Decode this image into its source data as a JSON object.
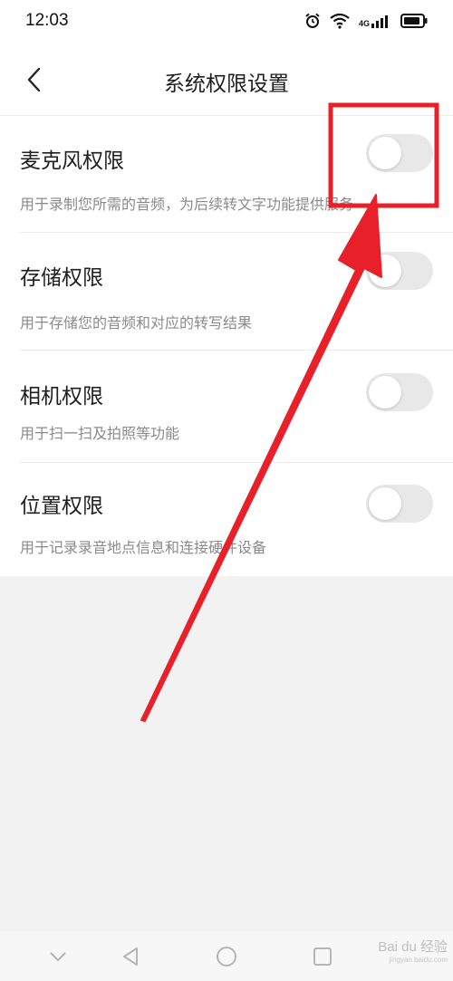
{
  "status_bar": {
    "time": "12:03",
    "network_label": "4G",
    "icons": [
      "alarm-icon",
      "wifi-icon",
      "signal-icon",
      "battery-icon"
    ]
  },
  "header": {
    "back_icon": "chevron-left-icon",
    "title": "系统权限设置"
  },
  "permissions": [
    {
      "title": "麦克风权限",
      "description": "用于录制您所需的音频，为后续转文字功能提供服务",
      "enabled": false
    },
    {
      "title": "存储权限",
      "description": "用于存储您的音频和对应的转写结果",
      "enabled": false
    },
    {
      "title": "相机权限",
      "description": "用于扫一扫及拍照等功能",
      "enabled": false
    },
    {
      "title": "位置权限",
      "description": "用于记录录音地点信息和连接硬件设备",
      "enabled": false
    }
  ],
  "nav_bar": {
    "buttons": [
      "collapse-icon",
      "back-triangle-icon",
      "home-circle-icon",
      "recents-square-icon"
    ]
  },
  "watermark": {
    "brand": "Bai du 经验",
    "url": "jingyan.baidu.com"
  },
  "colors": {
    "annotation_red": "#e8202a",
    "toggle_off": "#e8e8e8",
    "page_background": "#f2f2f2"
  }
}
